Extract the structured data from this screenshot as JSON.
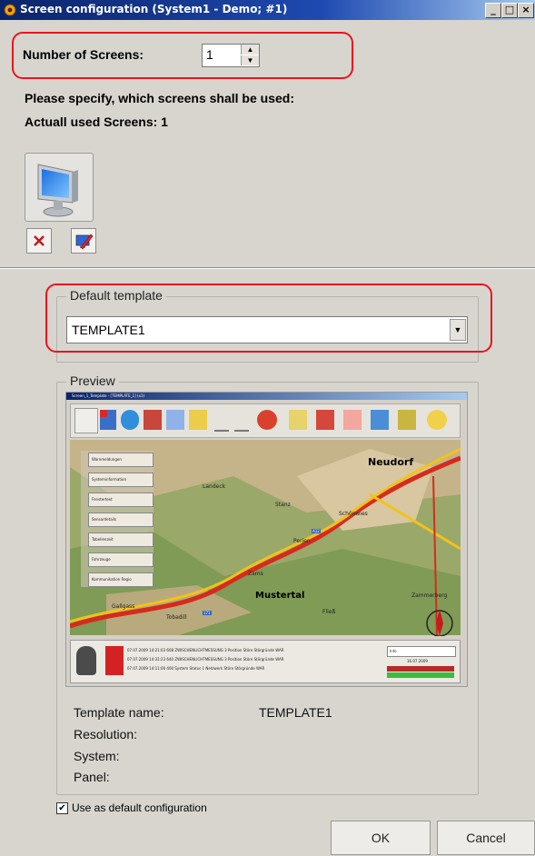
{
  "window": {
    "title": "Screen configuration (System1 - Demo; #1)",
    "controls": [
      "_",
      "□",
      "×"
    ]
  },
  "screens": {
    "count_label": "Number of Screens:",
    "count_value": "1",
    "instruction": "Please specify, which screens shall be used:",
    "used_label": "Actuall used Screens: 1",
    "icons": [
      "monitor-icon",
      "delete-icon",
      "edit-screen-icon"
    ]
  },
  "template": {
    "legend": "Default template",
    "selected": "TEMPLATE1"
  },
  "preview": {
    "legend": "Preview",
    "thumb": {
      "title": "Screen_1_Template - [TEMPLATE_1] (x1)",
      "left_menu": [
        "Warnmeldungen",
        "Systeminformation",
        "Fenstertext",
        "Sensordetails",
        "Tabellenzeit",
        "Fahrzeuge",
        "Kommunikation Regio"
      ],
      "map_places": [
        "Neudorf",
        "Mustertal",
        "Zams",
        "Stanz",
        "Landeck",
        "Schönwies",
        "Perjen",
        "Tobadill",
        "Gallgass",
        "Zammerberg",
        "Fließ"
      ],
      "map_roads": [
        "A12",
        "171"
      ],
      "alarms": [
        [
          "07.07.2009 14:21:03 608",
          "ZWISCHENLICHTMESSUNG 3",
          "Position",
          "Störe Störgründe",
          "WAR"
        ],
        [
          "07.07.2009 14:31:23 640",
          "ZWISCHENLICHTMESSUNG 3",
          "Position",
          "Störe Störgründe",
          "WAR"
        ],
        [
          "07.07.2009 14:11:00 400",
          "System Status 1",
          "Netzwerk",
          "Störe Störgründe",
          "WAR"
        ]
      ],
      "status": {
        "field": "Info",
        "date": "16.07.2009"
      }
    },
    "template_name_label": "Template name:",
    "template_name_value": "TEMPLATE1",
    "resolution_label": "Resolution:",
    "system_label": "System:",
    "panel_label": "Panel:"
  },
  "default_config": {
    "label": "Use as default configuration",
    "checked": true
  },
  "buttons": {
    "ok": "OK",
    "cancel": "Cancel"
  },
  "colors": {
    "highlight": "#e8151e",
    "titlebar": "#0a246a",
    "background": "#d8d5cf"
  }
}
